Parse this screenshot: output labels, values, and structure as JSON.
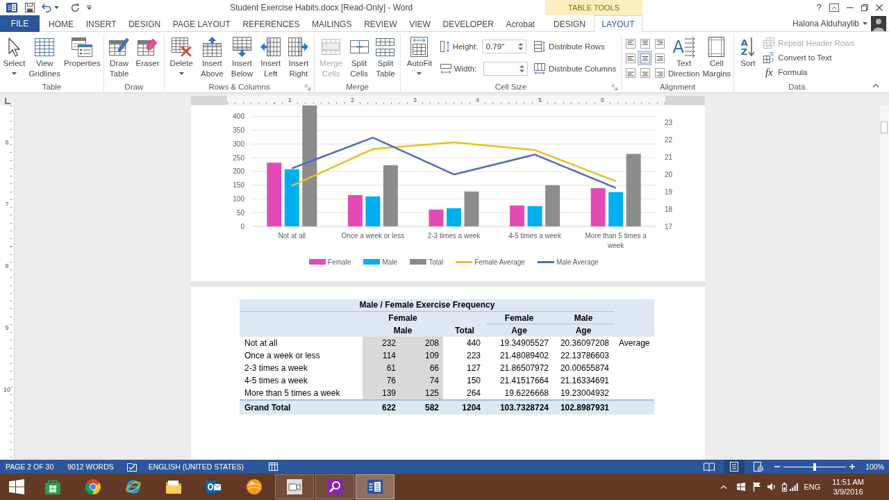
{
  "window": {
    "title": "Student Exercise Habits.docx [Read-Only] - Word",
    "context_group": "TABLE TOOLS",
    "help": "?"
  },
  "tabs": [
    {
      "label": "FILE",
      "kind": "file",
      "selected": false
    },
    {
      "label": "HOME",
      "kind": "main",
      "selected": false
    },
    {
      "label": "INSERT",
      "kind": "main",
      "selected": false
    },
    {
      "label": "DESIGN",
      "kind": "main",
      "selected": false
    },
    {
      "label": "PAGE LAYOUT",
      "kind": "main",
      "selected": false
    },
    {
      "label": "REFERENCES",
      "kind": "main",
      "selected": false
    },
    {
      "label": "MAILINGS",
      "kind": "main",
      "selected": false
    },
    {
      "label": "REVIEW",
      "kind": "main",
      "selected": false
    },
    {
      "label": "VIEW",
      "kind": "main",
      "selected": false
    },
    {
      "label": "DEVELOPER",
      "kind": "main",
      "selected": false
    },
    {
      "label": "Acrobat",
      "kind": "main",
      "selected": false
    },
    {
      "label": "DESIGN",
      "kind": "context",
      "selected": false
    },
    {
      "label": "LAYOUT",
      "kind": "context",
      "selected": true
    }
  ],
  "user": {
    "name": "Halona Alduhaylib"
  },
  "ribbon": {
    "groups": [
      {
        "label": "Table",
        "launcher": false,
        "controls": [
          {
            "kind": "large",
            "label": "Select",
            "dropdown": true,
            "disabled": false
          },
          {
            "kind": "large",
            "label": "View Gridlines",
            "dropdown": false,
            "disabled": false
          },
          {
            "kind": "large",
            "label": "Properties",
            "dropdown": false,
            "disabled": false
          }
        ]
      },
      {
        "label": "Draw",
        "launcher": false,
        "controls": [
          {
            "kind": "large",
            "label": "Draw Table",
            "dropdown": false,
            "disabled": false
          },
          {
            "kind": "large",
            "label": "Eraser",
            "dropdown": false,
            "disabled": false
          }
        ]
      },
      {
        "label": "Rows & Columns",
        "launcher": true,
        "controls": [
          {
            "kind": "large",
            "label": "Delete",
            "dropdown": true,
            "disabled": false
          },
          {
            "kind": "large",
            "label": "Insert Above",
            "dropdown": false,
            "disabled": false
          },
          {
            "kind": "large",
            "label": "Insert Below",
            "dropdown": false,
            "disabled": false
          },
          {
            "kind": "large",
            "label": "Insert Left",
            "dropdown": false,
            "disabled": false
          },
          {
            "kind": "large",
            "label": "Insert Right",
            "dropdown": false,
            "disabled": false
          }
        ]
      },
      {
        "label": "Merge",
        "launcher": false,
        "controls": [
          {
            "kind": "large",
            "label": "Merge Cells",
            "dropdown": false,
            "disabled": true
          },
          {
            "kind": "large",
            "label": "Split Cells",
            "dropdown": false,
            "disabled": false
          },
          {
            "kind": "large",
            "label": "Split Table",
            "dropdown": false,
            "disabled": false
          }
        ]
      },
      {
        "label": "Cell Size",
        "launcher": true,
        "controls": [
          {
            "kind": "large",
            "label": "AutoFit",
            "dropdown": true,
            "disabled": false
          },
          {
            "kind": "field",
            "label": "Height:",
            "value": "0.79\""
          },
          {
            "kind": "field",
            "label": "Width:"
          },
          {
            "kind": "small",
            "label": "Distribute Rows",
            "disabled": false
          },
          {
            "kind": "small",
            "label": "Distribute Columns",
            "disabled": false
          }
        ]
      },
      {
        "label": "Alignment",
        "launcher": false,
        "controls": [
          {
            "kind": "align-grid",
            "cells": [
              {
                "selected": false
              },
              {
                "selected": false
              },
              {
                "selected": false
              },
              {
                "selected": false
              },
              {
                "selected": true
              },
              {
                "selected": false
              },
              {
                "selected": false
              },
              {
                "selected": false
              },
              {
                "selected": false
              }
            ]
          },
          {
            "kind": "large",
            "label": "Text Direction",
            "glyph": "A",
            "dropdown": false,
            "disabled": false
          },
          {
            "kind": "large",
            "label": "Cell Margins",
            "dropdown": false,
            "disabled": false
          }
        ]
      },
      {
        "label": "Data",
        "launcher": false,
        "controls": [
          {
            "kind": "large",
            "label": "Sort",
            "glyph": "AZ",
            "dropdown": false,
            "disabled": false
          },
          {
            "kind": "small",
            "label": "Repeat Header Rows",
            "disabled": true
          },
          {
            "kind": "small",
            "label": "Convert to Text",
            "disabled": false
          },
          {
            "kind": "small",
            "label": "Formula",
            "glyph": "fx",
            "disabled": false
          }
        ]
      }
    ]
  },
  "document": {
    "ruler": {
      "horizontal": [
        "1",
        "2",
        "3",
        "4",
        "5",
        "6"
      ],
      "vertical": [
        "6",
        "7",
        "8",
        "9",
        "10"
      ]
    },
    "chart": {
      "chart_data": [
        {
          "type": "bar",
          "categories": [
            "Not at all",
            "Once a week or less",
            "2-3 times a week",
            "4-5 times a week",
            "More than 5 times a week"
          ],
          "series": [
            {
              "name": "Female",
              "color": "#e24bb5",
              "values": [
                232,
                114,
                61,
                76,
                139
              ]
            },
            {
              "name": "Male",
              "color": "#00aff0",
              "values": [
                208,
                109,
                66,
                74,
                125
              ]
            },
            {
              "name": "Total",
              "color": "#8c8c8c",
              "values": [
                440,
                223,
                127,
                150,
                264
              ]
            },
            {
              "name": "Female Average",
              "type": "line",
              "axis": "y2",
              "color": "#eabf1c",
              "values": [
                19.35,
                21.48,
                21.87,
                21.42,
                19.62
              ]
            },
            {
              "name": "Male Average",
              "type": "line",
              "axis": "y2",
              "color": "#4b6fb5",
              "values": [
                20.36,
                22.14,
                20.01,
                21.16,
                19.23
              ]
            }
          ],
          "ylim": [
            0,
            440
          ],
          "y2lim": [
            17,
            24
          ],
          "yticks": [
            0,
            50,
            100,
            150,
            200,
            250,
            300,
            350,
            400
          ],
          "y2ticks": [
            17,
            18,
            19,
            20,
            21,
            22,
            23
          ],
          "grid": true,
          "legend": "bottom"
        }
      ]
    },
    "table": {
      "title": "Male / Female Exercise Frequency",
      "header": [
        {
          "lines": [
            "Female",
            "Male"
          ]
        },
        {
          "lines": [
            "Total"
          ]
        },
        {
          "lines": [
            "Female",
            "Age"
          ]
        },
        {
          "lines": [
            "Male",
            "Age"
          ]
        }
      ],
      "rows": [
        {
          "label": "Not at all",
          "cells": [
            "232",
            "208",
            "440",
            "19.34905527",
            "20.36097208"
          ],
          "note": "Average"
        },
        {
          "label": "Once a week or less",
          "cells": [
            "114",
            "109",
            "223",
            "21.48089402",
            "22.13786603"
          ]
        },
        {
          "label": "2-3 times a week",
          "cells": [
            "61",
            "66",
            "127",
            "21.86507972",
            "20.00655874"
          ]
        },
        {
          "label": "4-5 times a week",
          "cells": [
            "76",
            "74",
            "150",
            "21.41517664",
            "21.16334691"
          ]
        },
        {
          "label": "More than 5 times a week",
          "cells": [
            "139",
            "125",
            "264",
            "19.6226668",
            "19.23004932"
          ]
        }
      ],
      "total": {
        "label": "Grand Total",
        "cells": [
          "622",
          "582",
          "1204",
          "103.7328724",
          "102.8987931"
        ]
      }
    }
  },
  "status_bar": {
    "page": "PAGE 2 OF 30",
    "words": "9012 WORDS",
    "language": "ENGLISH (UNITED STATES)",
    "views": [
      {
        "selected": false
      },
      {
        "selected": true
      },
      {
        "selected": false
      }
    ],
    "zoom": {
      "level": 0.5,
      "label": "100%"
    }
  },
  "taskbar": {
    "apps": [
      {
        "running": false,
        "active": false
      },
      {
        "running": false,
        "active": false
      },
      {
        "running": false,
        "active": false
      },
      {
        "running": false,
        "active": false
      },
      {
        "running": false,
        "active": false
      },
      {
        "running": false,
        "active": false
      },
      {
        "running": true,
        "active": false
      },
      {
        "running": true,
        "active": false
      },
      {
        "running": true,
        "active": true
      }
    ],
    "tray": {
      "language": "ENG",
      "time": "11:51 AM",
      "date": "3/9/2016"
    }
  }
}
